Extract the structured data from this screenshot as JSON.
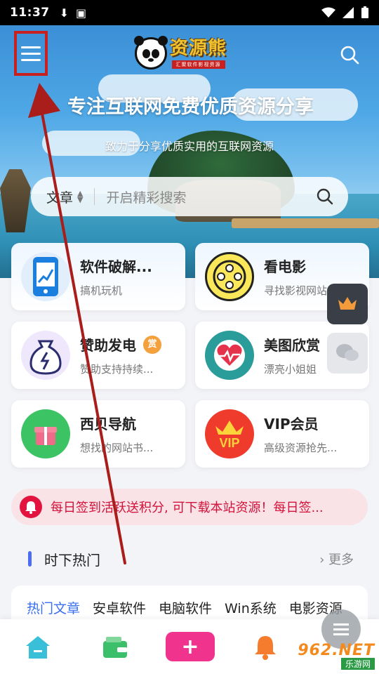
{
  "status_bar": {
    "time": "11:37"
  },
  "header": {
    "logo_text": "资源熊",
    "logo_sub": "汇聚软件影视资源",
    "title": "专注互联网免费优质资源分享",
    "subtitle": "致力于分享优质实用的互联网资源"
  },
  "search": {
    "type_label": "文章",
    "placeholder": "开启精彩搜索"
  },
  "cards": [
    {
      "title": "软件破解...",
      "subtitle": "搞机玩机",
      "icon": "phone-chart-icon"
    },
    {
      "title": "看电影",
      "subtitle": "寻找影视网站",
      "icon": "film-reel-icon"
    },
    {
      "title": "赞助发电",
      "badge": "赏",
      "subtitle": "赞助支持持续...",
      "icon": "money-bag-icon"
    },
    {
      "title": "美图欣赏",
      "subtitle": "漂亮小姐姐",
      "icon": "heart-pulse-icon"
    },
    {
      "title": "西贝导航",
      "subtitle": "想找的网站书...",
      "icon": "gift-icon"
    },
    {
      "title": "VIP会员",
      "subtitle": "高级资源抢先...",
      "icon": "vip-crown-icon"
    }
  ],
  "notice": {
    "text": "每日签到活跃送积分, 可下载本站资源！每日签..."
  },
  "section": {
    "title": "时下热门",
    "more": "› 更多"
  },
  "tabs": [
    "热门文章",
    "安卓软件",
    "电脑软件",
    "Win系统",
    "电影资源"
  ],
  "bottom_nav": [
    "home-icon",
    "wallet-icon",
    "plus-icon",
    "bell-icon"
  ],
  "watermark": {
    "line1": "962.NET",
    "line2": "乐游网"
  },
  "colors": {
    "accent": "#4a6cf7",
    "notice_text": "#d3123b",
    "plus_button": "#f0338d",
    "annotation_red": "#c8201f"
  }
}
